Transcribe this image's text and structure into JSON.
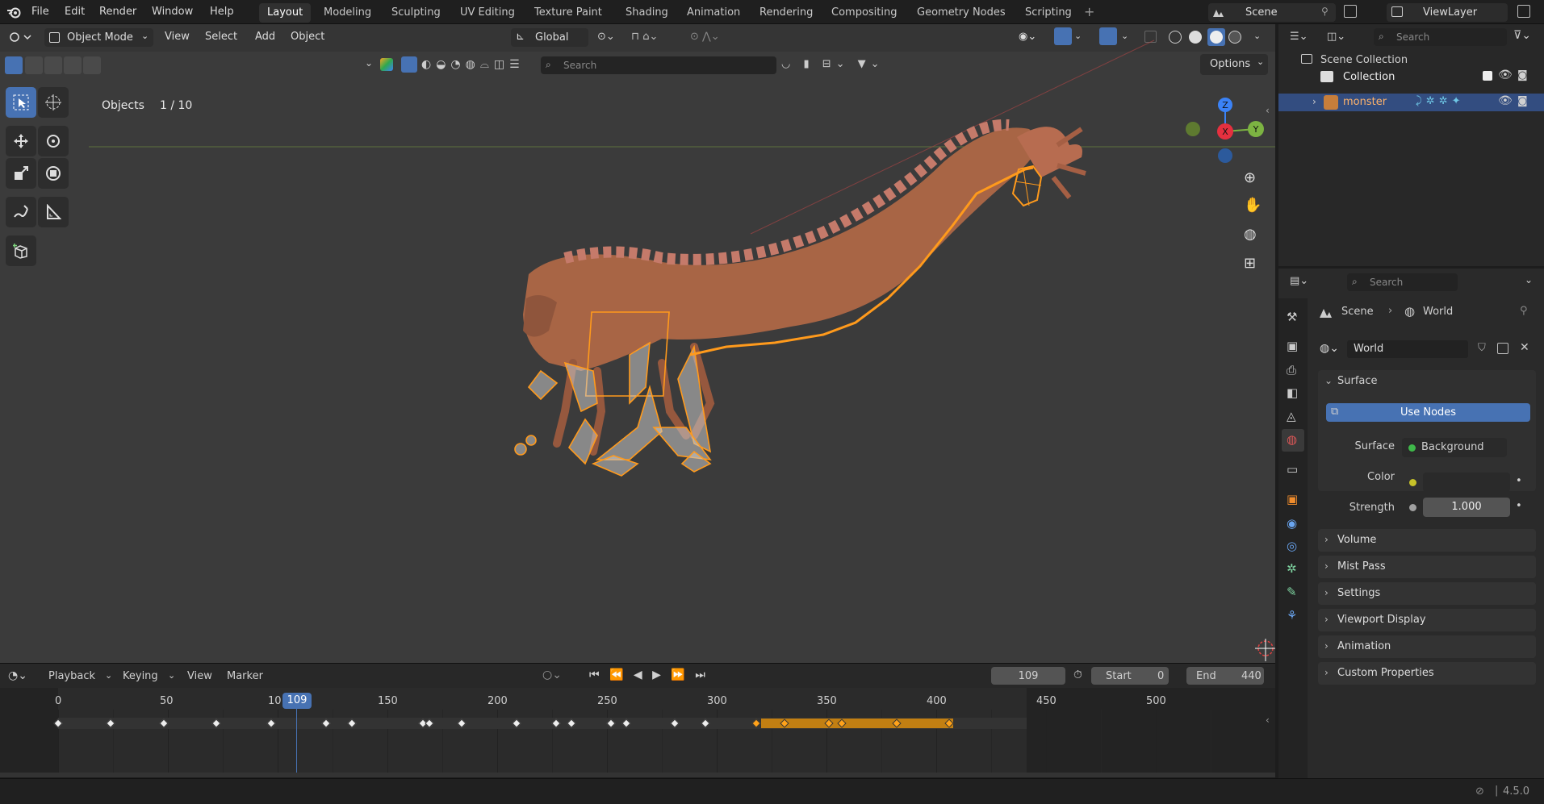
{
  "menu": {
    "items": [
      "File",
      "Edit",
      "Render",
      "Window",
      "Help"
    ],
    "workspaces": [
      "Layout",
      "Modeling",
      "Sculpting",
      "UV Editing",
      "Texture Paint",
      "Shading",
      "Animation",
      "Rendering",
      "Compositing",
      "Geometry Nodes",
      "Scripting"
    ],
    "active_workspace": "Layout",
    "scene_label": "Scene",
    "viewlayer_label": "ViewLayer"
  },
  "viewport_header": {
    "mode": "Object Mode",
    "menus": [
      "View",
      "Select",
      "Add",
      "Object"
    ],
    "transform_orientation": "Global",
    "search_placeholder": "Search",
    "options_label": "Options"
  },
  "viewport": {
    "objects_label": "Objects",
    "objects_count": "1 / 10",
    "gizmo_axes": [
      "Z",
      "X",
      "Y"
    ],
    "accent_color": "#4772b3",
    "selection_color": "#ff9a1c"
  },
  "outliner": {
    "search_placeholder": "Search",
    "scene_collection": "Scene Collection",
    "collection": "Collection",
    "object": "monster"
  },
  "properties": {
    "search_placeholder": "Search",
    "breadcrumb_scene": "Scene",
    "breadcrumb_world": "World",
    "world_name": "World",
    "surface_panel": "Surface",
    "use_nodes_label": "Use Nodes",
    "surface_label": "Surface",
    "surface_value": "Background",
    "color_label": "Color",
    "strength_label": "Strength",
    "strength_value": "1.000",
    "collapsed_panels": [
      "Volume",
      "Mist Pass",
      "Settings",
      "Viewport Display",
      "Animation",
      "Custom Properties"
    ]
  },
  "timeline": {
    "menus": [
      "Playback",
      "Keying",
      "View",
      "Marker"
    ],
    "current_frame": "109",
    "current_frame_badge": "109",
    "start_label": "Start",
    "start_value": "0",
    "end_label": "End",
    "end_value": "440",
    "ruler_labels": [
      "0",
      "50",
      "10",
      "150",
      "200",
      "250",
      "300",
      "350",
      "400",
      "450",
      "500"
    ],
    "keyframes": [
      0,
      24,
      48,
      72,
      97,
      122,
      134,
      166,
      169,
      184,
      209,
      227,
      234,
      252,
      259,
      281,
      295,
      318,
      331,
      351,
      357,
      382,
      406
    ],
    "selected_keyframes": [
      318,
      331,
      351,
      357,
      382,
      406
    ]
  },
  "status": {
    "version": "4.5.0"
  }
}
